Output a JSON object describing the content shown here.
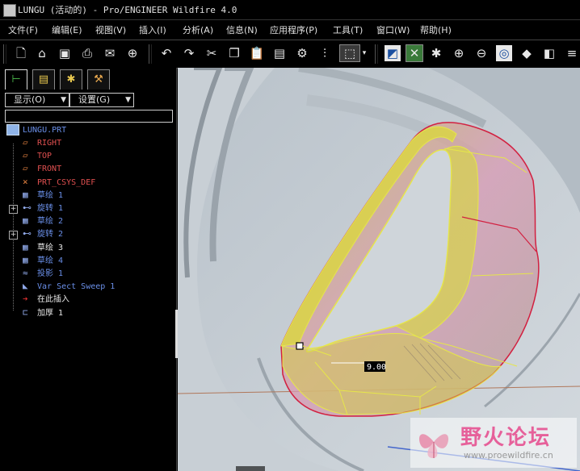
{
  "window": {
    "title": "LUNGU (活动的) - Pro/ENGINEER Wildfire 4.0"
  },
  "menu": [
    "文件(F)",
    "编辑(E)",
    "视图(V)",
    "插入(I)",
    "分析(A)",
    "信息(N)",
    "应用程序(P)",
    "工具(T)",
    "窗口(W)",
    "帮助(H)"
  ],
  "toolbar_icons": [
    "new-file-icon",
    "open-folder-icon",
    "save-icon",
    "print-icon",
    "send-mail-icon",
    "save-copy-icon",
    "undo-icon",
    "redo-icon",
    "cut-icon",
    "copy-icon",
    "paste-icon",
    "paste-special-icon",
    "regenerate-icon",
    "model-tree-icon",
    "select-box-icon",
    "repaint-icon",
    "spin-center-icon",
    "orient-icon",
    "zoom-in-icon",
    "zoom-out-icon",
    "refit-icon",
    "shading-icon",
    "saved-views-icon",
    "layers-icon"
  ],
  "panel": {
    "tabs": [
      "model-tree-tab-icon",
      "folder-browser-tab-icon",
      "favorites-tab-icon",
      "connections-tab-icon"
    ],
    "show_label": "显示(O)",
    "settings_label": "设置(G)",
    "filter_value": ""
  },
  "tree": {
    "root": "LUNGU.PRT",
    "items": [
      {
        "label": "RIGHT",
        "icon": "datum-plane-icon",
        "color": "#e05050"
      },
      {
        "label": "TOP",
        "icon": "datum-plane-icon",
        "color": "#e05050"
      },
      {
        "label": "FRONT",
        "icon": "datum-plane-icon",
        "color": "#e05050"
      },
      {
        "label": "PRT_CSYS_DEF",
        "icon": "coordinate-system-icon",
        "color": "#e05050"
      },
      {
        "label": "草绘 1",
        "icon": "sketch-icon",
        "color": "#6a8fe8"
      },
      {
        "label": "旋转 1",
        "icon": "revolve-icon",
        "color": "#6a8fe8",
        "expandable": true
      },
      {
        "label": "草绘 2",
        "icon": "sketch-icon",
        "color": "#6a8fe8"
      },
      {
        "label": "旋转 2",
        "icon": "revolve-icon",
        "color": "#6a8fe8",
        "expandable": true
      },
      {
        "label": "草绘 3",
        "icon": "sketch-icon",
        "color": "#e8e8e8"
      },
      {
        "label": "草绘 4",
        "icon": "sketch-icon",
        "color": "#6a8fe8"
      },
      {
        "label": "投影 1",
        "icon": "projected-curve-icon",
        "color": "#6a8fe8"
      },
      {
        "label": "Var Sect Sweep 1",
        "icon": "var-sect-sweep-icon",
        "color": "#6a8fe8"
      },
      {
        "label": "在此插入",
        "icon": "insert-here-arrow-icon",
        "color": "#e8e8e8"
      },
      {
        "label": "加厚 1",
        "icon": "thicken-icon",
        "color": "#e8e8e8"
      }
    ]
  },
  "viewport": {
    "dimension_text": "9.00"
  },
  "watermark": {
    "text": "野火论坛",
    "url": "www.proewildfire.cn"
  }
}
